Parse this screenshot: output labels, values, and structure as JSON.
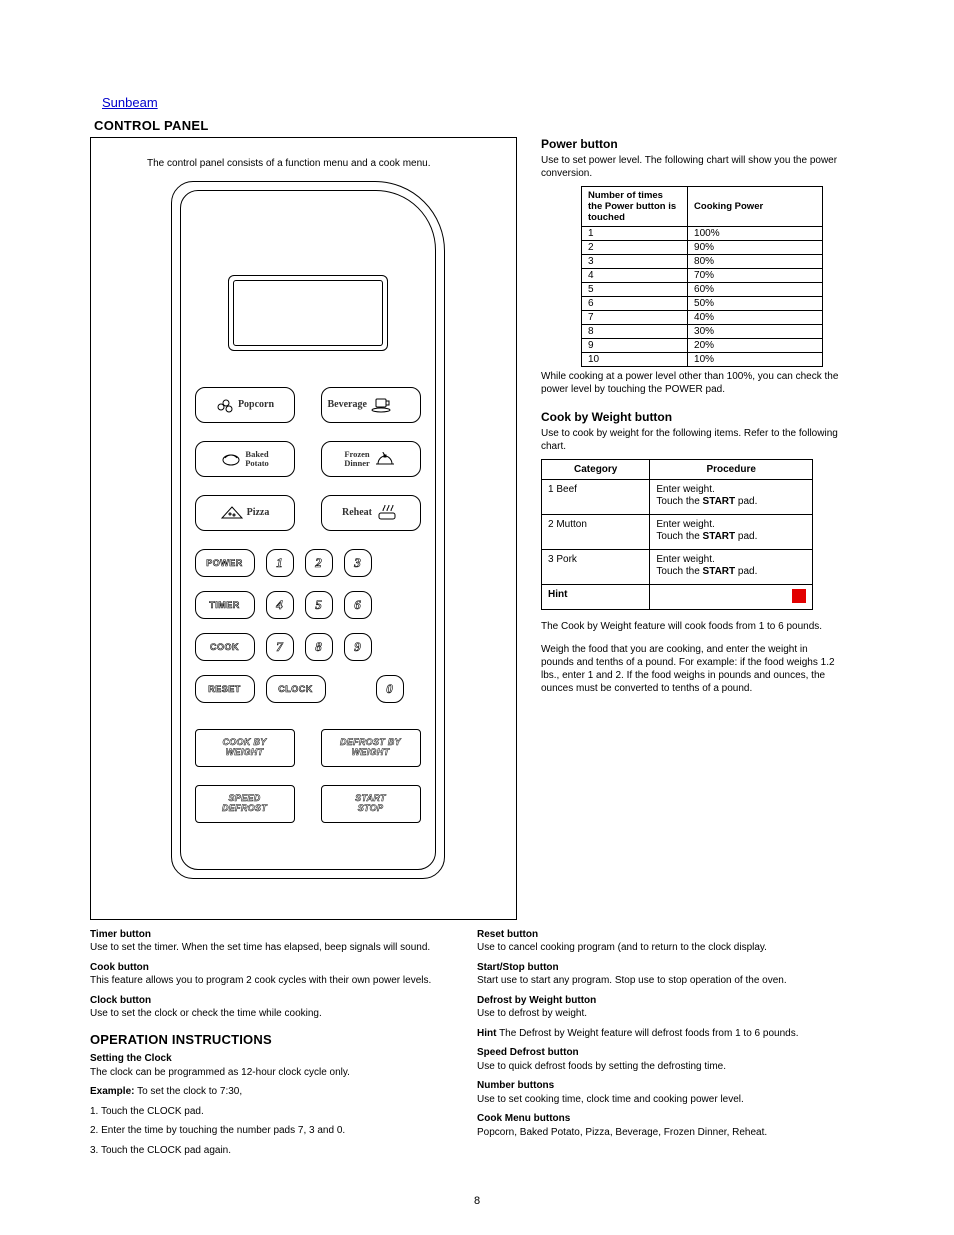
{
  "brand": "Sunbeam",
  "section_title": "CONTROL PANEL",
  "lead_paragraph": "The control panel consists of a function menu and a cook menu.",
  "panel": {
    "food_buttons": [
      {
        "label": "Popcorn",
        "name": "popcorn-button",
        "icon": "popcorn-icon"
      },
      {
        "label": "Beverage",
        "name": "beverage-button",
        "icon": "beverage-icon"
      },
      {
        "label": "Baked\nPotato",
        "name": "baked-potato-button",
        "icon": "potato-icon"
      },
      {
        "label": "Frozen\nDinner",
        "name": "frozen-dinner-button",
        "icon": "dinner-icon"
      },
      {
        "label": "Pizza",
        "name": "pizza-button",
        "icon": "pizza-icon"
      },
      {
        "label": "Reheat",
        "name": "reheat-button",
        "icon": "reheat-icon"
      }
    ],
    "keys": {
      "power": "POWER",
      "timer": "TIMER",
      "cook": "COOK",
      "reset": "RESET",
      "clock": "CLOCK",
      "n1": "1",
      "n2": "2",
      "n3": "3",
      "n4": "4",
      "n5": "5",
      "n6": "6",
      "n7": "7",
      "n8": "8",
      "n9": "9",
      "n0": "0",
      "cook_by_weight": "COOK BY\nWEIGHT",
      "defrost_by_weight": "DEFROST BY\nWEIGHT",
      "speed_defrost": "SPEED\nDEFROST",
      "start_stop": "START\nSTOP"
    }
  },
  "right": {
    "power_title": "Power button",
    "power_sub": "Use to set power level. The following chart will show you the power conversion.",
    "power_table": {
      "head_left": "Number of times\nthe Power button is touched",
      "head_right": "Cooking Power",
      "rows": [
        [
          "1",
          "100%"
        ],
        [
          "2",
          "90%"
        ],
        [
          "3",
          "80%"
        ],
        [
          "4",
          "70%"
        ],
        [
          "5",
          "60%"
        ],
        [
          "6",
          "50%"
        ],
        [
          "7",
          "40%"
        ],
        [
          "8",
          "30%"
        ],
        [
          "9",
          "20%"
        ],
        [
          "10",
          "10%"
        ]
      ]
    },
    "power_note": "While cooking at a power level other than 100%, you can check the power level by touching the POWER pad.",
    "cook_by_weight_title": "Cook by Weight button",
    "cook_by_weight_sub": "Use to cook by weight for the following items. Refer to the following chart.",
    "cook_table": {
      "head_left": "Category",
      "head_right": "Procedure",
      "rows": [
        {
          "cat": "1 Beef",
          "proc": [
            "Enter weight.",
            "<b>START</b> pad"
          ]
        },
        {
          "cat": "2 Mutton",
          "proc": [
            "Enter weight.",
            "<b>START</b> pad"
          ]
        },
        {
          "cat": "3 Pork",
          "proc": [
            "Enter weight.",
            "<b>START</b> pad"
          ]
        },
        {
          "cat": "",
          "proc_hint": "hint_row"
        }
      ]
    },
    "hint": "Hint",
    "hint_text_a": "The Cook by Weight feature will cook foods from 1 to 6 pounds.",
    "hint_text_b": "Weigh the food that you are cooking, and enter the weight in pounds and tenths of a pound. For example: if the food weighs 1.2 lbs., enter 1 and 2. If the food weighs in pounds and ounces, the ounces must be converted to tenths of a pound.",
    "reset": {
      "title": "Reset button",
      "text": "Use to cancel cooking program (and to return to the clock display."
    },
    "start_stop_t": "Start/Stop button",
    "start_stop_text": "Start use to start any program. Stop use to stop operation of the oven."
  },
  "bottom": {
    "timer": {
      "title": "Timer button",
      "text": "Use to set the timer. When the set time has elapsed, beep signals will sound."
    },
    "cook": {
      "title": "Cook button",
      "text": "This feature allows you to program 2 cook cycles with their own power levels."
    },
    "clock": {
      "title": "Clock button",
      "text": "Use to set the clock or check the time while cooking."
    },
    "operation_title": "OPERATION INSTRUCTIONS",
    "clock_set": {
      "title": "Setting the Clock",
      "text": "The clock can be programmed as 12-hour clock cycle only."
    },
    "example_t": "Example:",
    "example": "To set the clock to 7:30,",
    "steps": [
      "1. Touch the CLOCK pad.",
      "2. Enter the time by touching the number pads 7, 3 and 0.",
      "3. Touch the CLOCK pad again."
    ],
    "defrost_wt": {
      "title": "Defrost by Weight button",
      "text": "Use to defrost by weight."
    },
    "defrost_hint": "The Defrost by Weight feature will defrost foods from 1 to 6 pounds.",
    "speed_def": {
      "title": "Speed Defrost button",
      "text": "Use to quick defrost foods by setting the defrosting time."
    },
    "number": {
      "title": "Number buttons",
      "text": "Use to set cooking time, clock time and cooking power level."
    },
    "cook_menu": {
      "title": "Cook Menu buttons",
      "text": "Popcorn, Baked Potato, Pizza, Beverage, Frozen Dinner, Reheat."
    }
  },
  "page_number": "8"
}
